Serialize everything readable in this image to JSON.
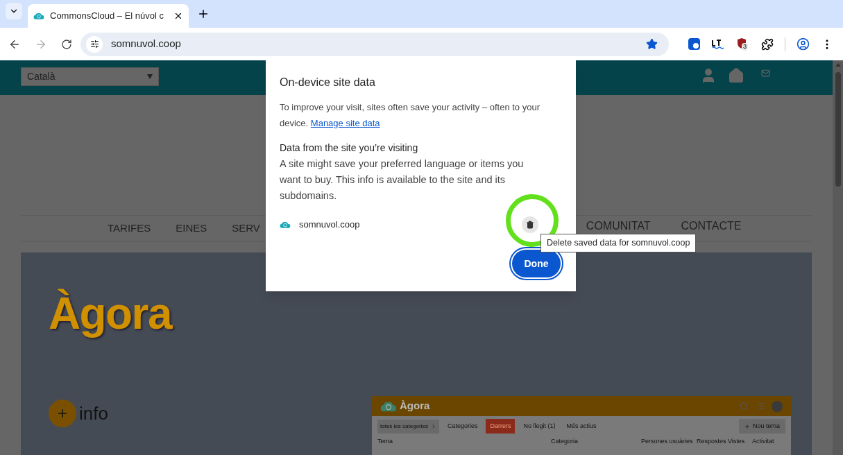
{
  "browser": {
    "tab_title": "CommonsCloud – El núvol c",
    "url": "somnuvol.coop",
    "extension_badge": "3"
  },
  "page": {
    "language": "Català",
    "nav": [
      "TARIFES",
      "EINES",
      "SERV",
      "COMUNITAT",
      "CONTACTE"
    ],
    "hero": {
      "title": "Àgora",
      "info": "info"
    },
    "preview": {
      "title": "Àgora",
      "category_filter": "totes les categories",
      "new_topic": "Nou tema",
      "tabs": [
        {
          "label": "Categories",
          "selected": false
        },
        {
          "label": "Darrers",
          "selected": true
        },
        {
          "label": "No llegit (1)",
          "selected": false
        },
        {
          "label": "Més actius",
          "selected": false
        }
      ],
      "columns": [
        "Tema",
        "Categoria",
        "Persones usuàries",
        "Respostes",
        "Vistes",
        "Activitat"
      ]
    }
  },
  "dialog": {
    "title": "On-device site data",
    "intro": "To improve your visit, sites often save your activity – often to your device.",
    "link": "Manage site data",
    "section_title": "Data from the site you’re visiting",
    "section_text": "A site might save your preferred language or items you want to buy. This info is available to the site and its subdomains.",
    "site": "somnuvol.coop",
    "tooltip": "Delete saved data for somnuvol.coop",
    "done": "Done"
  }
}
